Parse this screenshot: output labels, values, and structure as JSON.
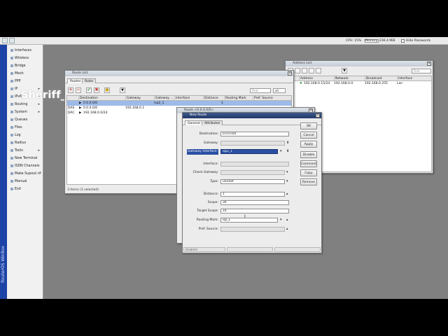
{
  "topbar": {
    "cpu_label": "CPU: 15%",
    "memory_label": "Memory: 236.4 MiB",
    "hide_passwords_label": "Hide Passwords"
  },
  "sidebar": {
    "brand": "RouterOS WinBox",
    "items": [
      {
        "label": "Interfaces",
        "arrow": ""
      },
      {
        "label": "Wireless",
        "arrow": ""
      },
      {
        "label": "Bridge",
        "arrow": ""
      },
      {
        "label": "Mesh",
        "arrow": ""
      },
      {
        "label": "PPP",
        "arrow": ""
      },
      {
        "label": "IP",
        "arrow": "▸"
      },
      {
        "label": "IPv6",
        "arrow": "▸"
      },
      {
        "label": "Routing",
        "arrow": "▸"
      },
      {
        "label": "System",
        "arrow": "▸"
      },
      {
        "label": "Queues",
        "arrow": ""
      },
      {
        "label": "Files",
        "arrow": ""
      },
      {
        "label": "Log",
        "arrow": ""
      },
      {
        "label": "Radius",
        "arrow": ""
      },
      {
        "label": "Tools",
        "arrow": "▸"
      },
      {
        "label": "New Terminal",
        "arrow": ""
      },
      {
        "label": "ISDN Channels",
        "arrow": ""
      },
      {
        "label": "Make Supout.rif",
        "arrow": ""
      },
      {
        "label": "Manual",
        "arrow": ""
      },
      {
        "label": "Exit",
        "arrow": ""
      }
    ]
  },
  "watermark": "Sheriff_",
  "route_list": {
    "title": "Route List",
    "tabs": [
      "Routes",
      "Rules"
    ],
    "find_placeholder": "Find",
    "filter_value": "all",
    "columns": [
      "Destination",
      "Gateway",
      "Gateway ...",
      "Interface",
      "Distance",
      "Routing Mark",
      "Pref. Source"
    ],
    "rows": [
      {
        "flag": "",
        "destination": "0.0.0.0/0",
        "gateway": "",
        "gateway_state": "isp2_1",
        "interface": "",
        "distance": "1",
        "routing_mark": "",
        "pref_source": ""
      },
      {
        "flag": "DAS",
        "destination": "0.0.0.0/0",
        "gateway": "192.168.0.1",
        "gateway_state": "",
        "interface": "",
        "distance": "",
        "routing_mark": "",
        "pref_source": ""
      },
      {
        "flag": "DAC",
        "destination": "192.168.0.0/24",
        "gateway": "",
        "gateway_state": "",
        "interface": "",
        "distance": "",
        "routing_mark": "",
        "pref_source": ""
      }
    ],
    "status": "3 items (1 selected)"
  },
  "address_list": {
    "title": "Address List",
    "find_placeholder": "Find",
    "columns": [
      "Address",
      "Network",
      "Broadcast",
      "Interface"
    ],
    "rows": [
      {
        "address": "192.168.0.15/24",
        "network": "192.168.0.0",
        "broadcast": "192.168.0.255",
        "interface": "Lan"
      }
    ]
  },
  "route_behind": {
    "title": "Route <0.0.0.0/0>"
  },
  "new_route": {
    "title": "New Route",
    "tabs": [
      "General",
      "Attributes"
    ],
    "fields": {
      "destination": {
        "label": "Destination:",
        "value": "0.0.0.0/0"
      },
      "gateway": {
        "label": "Gateway:",
        "value": ""
      },
      "gateway_interface": {
        "label": "Gateway Interface:",
        "value": "isp2_1"
      },
      "interface": {
        "label": "Interface:",
        "value": ""
      },
      "check_gateway": {
        "label": "Check Gateway:",
        "value": ""
      },
      "type": {
        "label": "Type:",
        "value": "unicast"
      },
      "distance": {
        "label": "Distance:",
        "value": "1"
      },
      "scope": {
        "label": "Scope:",
        "value": "30"
      },
      "target_scope": {
        "label": "Target Scope:",
        "value": "10"
      },
      "routing_mark": {
        "label": "Routing Mark:",
        "value": "isp_1"
      },
      "pref_source": {
        "label": "Pref. Source:",
        "value": ""
      }
    },
    "buttons": {
      "ok": "OK",
      "cancel": "Cancel",
      "apply": "Apply",
      "disable": "Disable",
      "comment": "Comment",
      "copy": "Copy",
      "remove": "Remove"
    },
    "status_left": "disabled"
  }
}
